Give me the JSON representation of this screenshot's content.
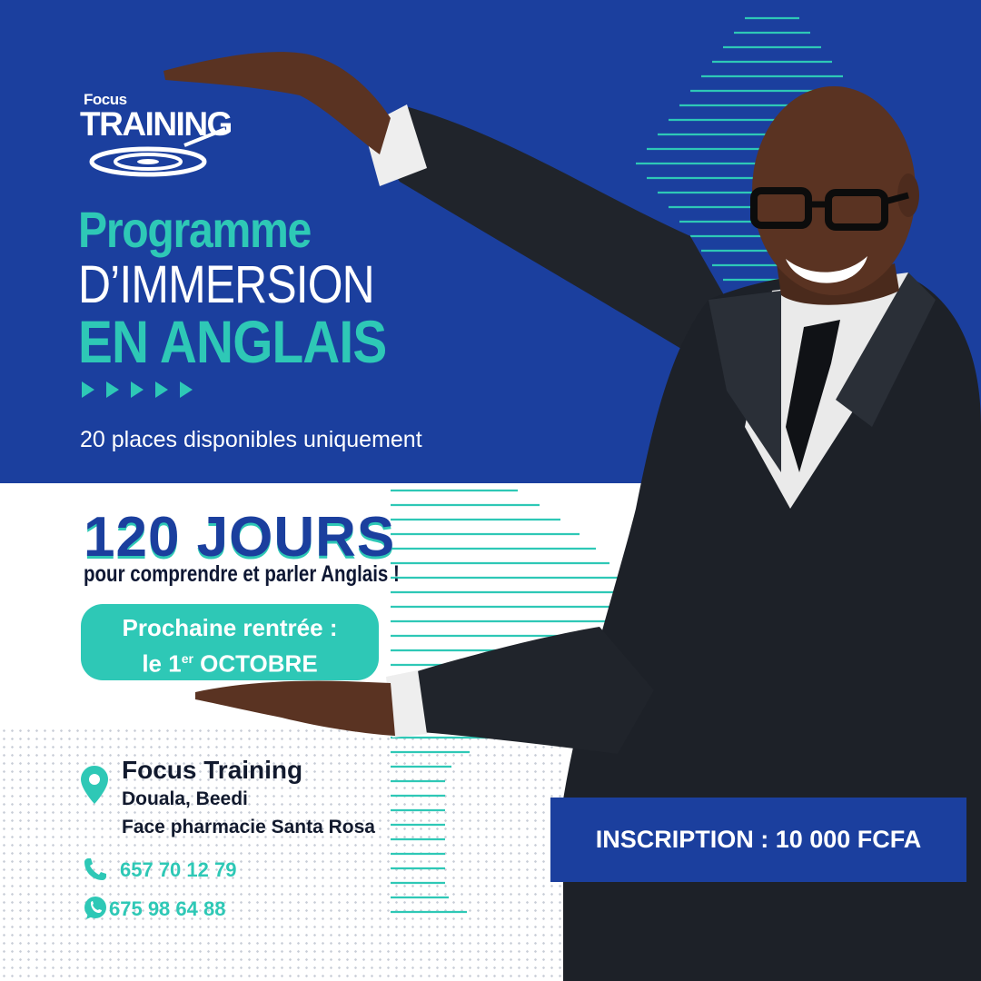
{
  "brand": {
    "line1": "Focus",
    "line2": "TRAINING",
    "icon": "target-swoosh-logo"
  },
  "headline": {
    "line1": "Programme",
    "line2": "D’IMMERSION",
    "line3": "EN ANGLAIS"
  },
  "places": "20 places disponibles uniquement",
  "duration": {
    "title": "120 JOURS",
    "subtitle": "pour comprendre et parler Anglais !"
  },
  "next_session": {
    "line1": "Prochaine rentrée :",
    "line2_pre": "le 1",
    "line2_sup": "er",
    "line2_post": " OCTOBRE"
  },
  "address": {
    "name": "Focus Training",
    "line1": "Douala, Beedi",
    "line2": "Face pharmacie Santa Rosa",
    "icon": "location-pin-icon"
  },
  "contacts": [
    {
      "icon": "phone-icon",
      "number": "657 70 12 79"
    },
    {
      "icon": "whatsapp-icon",
      "number": "675 98 64 88"
    }
  ],
  "inscription": "INSCRIPTION : 10 000 FCFA",
  "colors": {
    "blue": "#1b3f9e",
    "teal": "#2ec8b6",
    "dark": "#121a2e",
    "white": "#ffffff"
  }
}
